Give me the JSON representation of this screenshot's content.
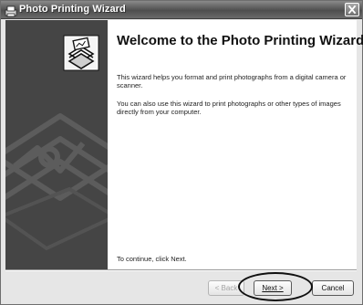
{
  "window": {
    "title": "Photo Printing Wizard",
    "title_icon": "wizard-icon",
    "close_icon": "close-icon"
  },
  "side_panel": {
    "icon": "printer-photo-icon"
  },
  "content": {
    "heading": "Welcome to the Photo Printing Wizard",
    "paragraph1": "This wizard helps you format and print photographs from a digital camera or scanner.",
    "paragraph2": "You can also use this wizard to print photographs or other types of images directly from your computer.",
    "continue_text": "To continue, click Next."
  },
  "buttons": {
    "back": "< Back",
    "next": "Next >",
    "cancel": "Cancel"
  },
  "colors": {
    "titlebar": "#595959",
    "side_panel": "#454545",
    "content_bg": "#ffffff",
    "window_bg": "#e6e6e6"
  }
}
